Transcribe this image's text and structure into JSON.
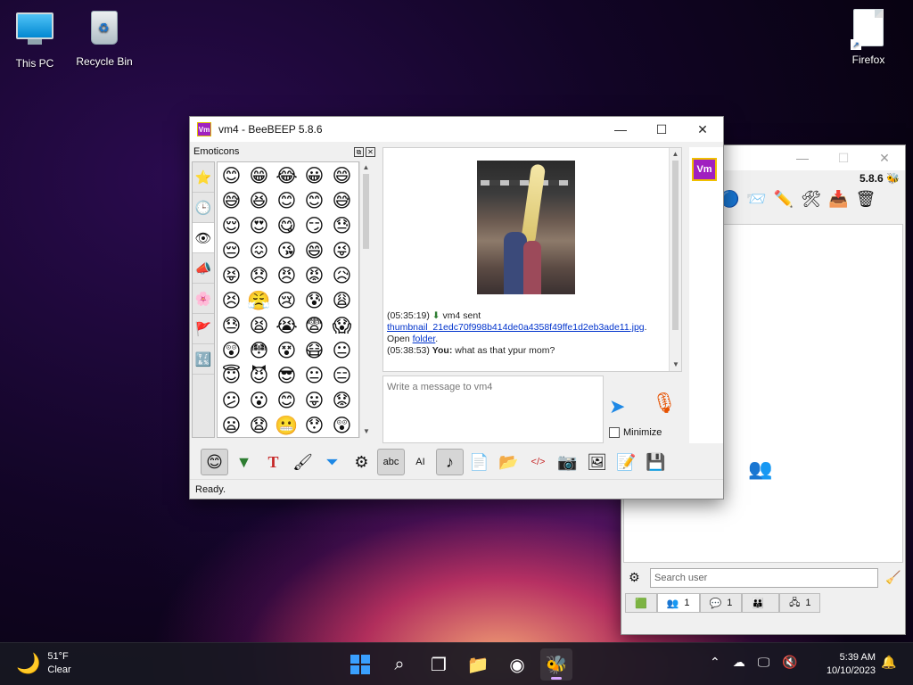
{
  "desktop": {
    "icons": [
      {
        "label": "This PC"
      },
      {
        "label": "Recycle Bin"
      },
      {
        "label": "Firefox"
      }
    ]
  },
  "main_window": {
    "title": "vm4 - BeeBEEP 5.8.6",
    "app_badge": "Vm",
    "controls": {
      "minimize": "—",
      "maximize": "☐",
      "close": "✕"
    },
    "emoticons_label": "Emoticons",
    "emoticons": [
      "😊",
      "😁",
      "😂",
      "😀",
      "😄",
      "😅",
      "😆",
      "😊",
      "😊",
      "😅",
      "😌",
      "😍",
      "😋",
      "😏",
      "😓",
      "😔",
      "😖",
      "😘",
      "😄",
      "😜",
      "😝",
      "😞",
      "😠",
      "😡",
      "😥",
      "😣",
      "😤",
      "😢",
      "😰",
      "😩",
      "😓",
      "😫",
      "😭",
      "😨",
      "😱",
      "😲",
      "😳",
      "😵",
      "😷",
      "😐",
      "😇",
      "😈",
      "😎",
      "😐",
      "😑",
      "😕",
      "😮",
      "😊",
      "😛",
      "😟",
      "😦",
      "😧",
      "😬",
      "😯",
      "😲"
    ],
    "emoticon_tabs": [
      "⭐",
      "🕒",
      "👁",
      "📣",
      "🌸",
      "🚩",
      "🔣"
    ],
    "chat": {
      "log_time1": "(05:35:19)",
      "log_sender": "vm4 sent",
      "file_link": "thumbnail_21edc70f998b414de0a4358f49ffe1d2eb3ade11.jpg",
      "open_prefix": "Open",
      "folder_link": "folder",
      "log_time2": "(05:38:53)",
      "you_label": "You:",
      "message": "what as that ypur mom?"
    },
    "compose_placeholder": "Write a message to vm4",
    "minimize_label": "Minimize",
    "status": "Ready.",
    "toolbar_icons": [
      "smiley",
      "green-arrow",
      "font",
      "brush",
      "filter",
      "gear",
      "spell",
      "ai",
      "music",
      "send-file",
      "send-folder",
      "code",
      "camera",
      "screenshot",
      "notes",
      "save"
    ]
  },
  "back_window": {
    "version": "5.8.6",
    "search_placeholder": "Search user",
    "tabs": [
      {
        "count": "1"
      },
      {
        "count": "1"
      },
      {
        "count": ""
      },
      {
        "count": "1"
      }
    ]
  },
  "taskbar": {
    "temp": "51°F",
    "condition": "Clear",
    "time": "5:39 AM",
    "date": "10/10/2023"
  }
}
